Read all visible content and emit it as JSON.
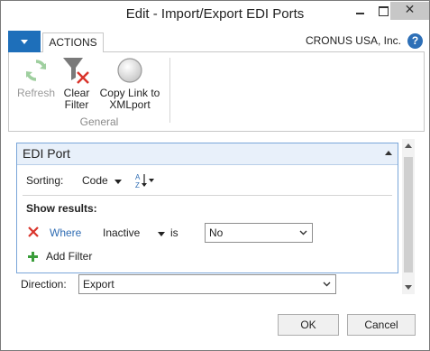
{
  "window": {
    "title": "Edit - Import/Export EDI Ports",
    "close_glyph": "✕"
  },
  "ribbon": {
    "tab_label": "ACTIONS",
    "company": "CRONUS USA, Inc.",
    "help_glyph": "?",
    "group_label": "General",
    "buttons": {
      "refresh": {
        "line1": "Refresh",
        "line2": ""
      },
      "clear_filter": {
        "line1": "Clear",
        "line2": "Filter"
      },
      "copy_link": {
        "line1": "Copy Link to",
        "line2": "XMLport"
      }
    }
  },
  "fasttab": {
    "title": "EDI Port",
    "sorting_label": "Sorting:",
    "sorting_value": "Code",
    "show_results_label": "Show results:",
    "filter": {
      "where_label": "Where",
      "field": "Inactive",
      "operator": "is",
      "value": "No"
    },
    "add_filter_label": "Add Filter"
  },
  "direction": {
    "label": "Direction:",
    "value": "Export"
  },
  "buttons": {
    "ok": "OK",
    "cancel": "Cancel"
  },
  "icons": {
    "app_menu": "dropdown-menu-icon",
    "refresh": "refresh-icon",
    "clear_filter": "funnel-clear-icon",
    "copy_link": "circle-icon",
    "sort_order": "sort-az-icon",
    "remove_filter": "red-x-icon",
    "add_filter": "green-plus-icon",
    "help": "help-icon"
  },
  "colors": {
    "accent": "#1e6fba",
    "fasttab_border": "#7aa6d9",
    "where_link": "#2f6cb3",
    "remove_x": "#d9342b",
    "add_plus": "#3a9d3a"
  }
}
